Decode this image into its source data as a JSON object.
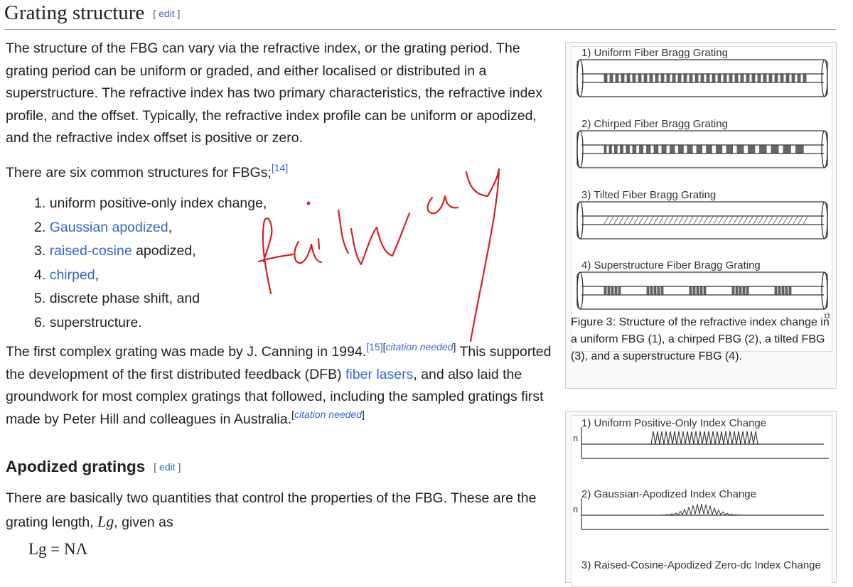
{
  "section": {
    "title": "Grating structure",
    "edit_open": "[",
    "edit_label": "edit",
    "edit_close": "]"
  },
  "intro": {
    "p1": "The structure of the FBG can vary via the refractive index, or the grating period. The grating period can be uniform or graded, and either localised or distributed in a superstructure. The refractive index has two primary characteristics, the refractive index profile, and the offset. Typically, the refractive index profile can be uniform or apodized, and the refractive index offset is positive or zero.",
    "p2_text": "There are six common structures for FBGs;",
    "p2_ref": "[14]"
  },
  "list": [
    {
      "num": "1. ",
      "link": "",
      "text": "uniform positive-only index change,"
    },
    {
      "num": "2. ",
      "link": "Gaussian apodized",
      "text": ","
    },
    {
      "num": "3. ",
      "link": "raised-cosine",
      "text": " apodized,"
    },
    {
      "num": "4. ",
      "link": "chirped",
      "text": ","
    },
    {
      "num": "5. ",
      "link": "",
      "text": "discrete phase shift, and"
    },
    {
      "num": "6. ",
      "link": "",
      "text": "superstructure."
    }
  ],
  "p3": {
    "a": "The first complex grating was made by J. Canning in 1994.",
    "ref1": "[15]",
    "cn_open": "[",
    "cn": "citation needed",
    "cn_close": "]",
    "b": " This supported the development of the first distributed feedback (DFB) ",
    "link": "fiber lasers",
    "c": ", and also laid the groundwork for most complex gratings that followed, including the sampled gratings first made by Peter Hill and colleagues in Australia.",
    "cn2_open": "[",
    "cn2": "citation needed",
    "cn2_close": "]"
  },
  "apod": {
    "title": "Apodized gratings",
    "edit_open": "[",
    "edit_label": "edit",
    "edit_close": "]",
    "p_a": "There are basically two quantities that control the properties of the FBG. These are the grating length, ",
    "var": "Lg",
    "p_b": ", given as",
    "formula": "Lg = NΛ"
  },
  "figure3": {
    "labels": [
      "1) Uniform Fiber Bragg Grating",
      "2) Chirped Fiber Bragg Grating",
      "3) Tilted Fiber Bragg Grating",
      "4) Superstructure Fiber Bragg Grating"
    ],
    "caption": "Figure 3: Structure of the refractive index change in a uniform FBG (1), a chirped FBG (2), a tilted FBG (3), and a superstructure FBG (4)."
  },
  "figure4": {
    "labels": [
      "1) Uniform Positive-Only Index Change",
      "2) Gaussian-Apodized Index Change",
      "3) Raised-Cosine-Apodized Zero-dc Index Change"
    ],
    "axis": "n"
  },
  "annotation": {
    "text": "railway",
    "color": "#d91e1e"
  },
  "colors": {
    "link": "#3366cc",
    "text": "#202122",
    "rule": "#a2a9b1",
    "ink": "#d91e1e"
  }
}
